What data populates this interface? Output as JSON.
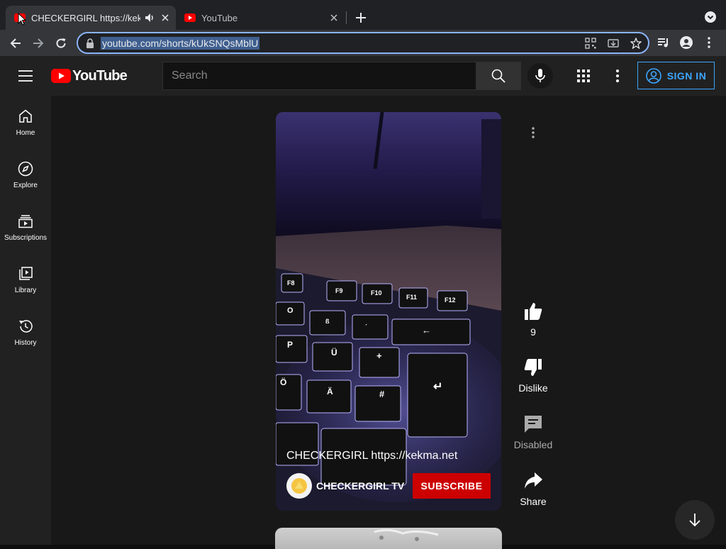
{
  "browser": {
    "tabs": [
      {
        "title": "CHECKERGIRL https://kekma.net",
        "active": true,
        "playing_audio": true
      },
      {
        "title": "YouTube",
        "active": false
      }
    ],
    "url": "youtube.com/shorts/kUkSNQsMblU"
  },
  "masthead": {
    "logo_text": "YouTube",
    "search_placeholder": "Search",
    "signin_label": "SIGN IN"
  },
  "guide": {
    "items": [
      {
        "label": "Home",
        "icon": "home-icon"
      },
      {
        "label": "Explore",
        "icon": "explore-icon"
      },
      {
        "label": "Subscriptions",
        "icon": "subscriptions-icon"
      },
      {
        "label": "Library",
        "icon": "library-icon"
      },
      {
        "label": "History",
        "icon": "history-icon"
      }
    ]
  },
  "short": {
    "title": "CHECKERGIRL https://kekma.net",
    "channel_name": "CHECKERGIRL TV",
    "subscribe_label": "SUBSCRIBE",
    "keyboard_keys": [
      "F8",
      "F9",
      "F10",
      "F11",
      "F12",
      "ß",
      "´",
      "+",
      "#",
      "Ö",
      "Ä",
      "Ü",
      "P",
      "O",
      "←",
      "↵"
    ]
  },
  "actions": {
    "likes": "9",
    "dislike": "Dislike",
    "comments": "Disabled",
    "share": "Share"
  },
  "colors": {
    "accent_blue": "#3ea6ff",
    "subscribe_red": "#cc0000",
    "brand_red": "#ff0000",
    "background": "#181818"
  }
}
